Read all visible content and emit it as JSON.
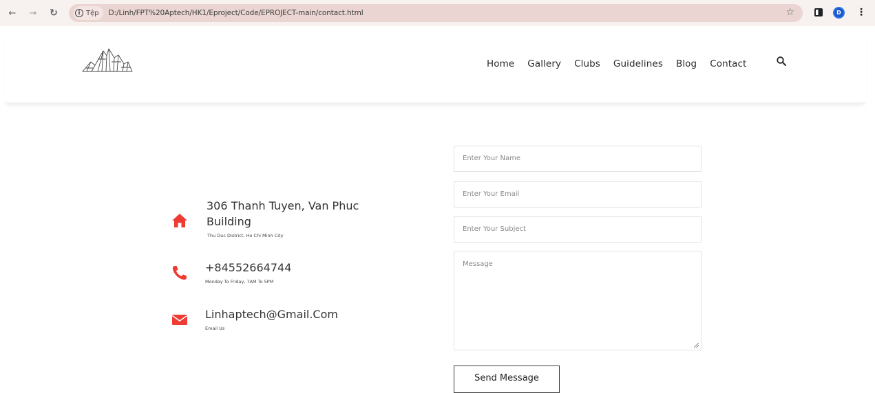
{
  "browser": {
    "site_label": "Tệp",
    "url": "D:/Linh/FPT%20Aptech/HK1/Eproject/Code/EPROJECT-main/contact.html",
    "profile_initial": "D"
  },
  "nav": {
    "items": [
      "Home",
      "Gallery",
      "Clubs",
      "Guidelines",
      "Blog",
      "Contact"
    ]
  },
  "contact": {
    "address": {
      "line1": "306 Thanh Tuyen, Van Phuc",
      "line2": "Building",
      "sub": "Thu Duc District, Ho Chi Minh City",
      "icon": "home-icon"
    },
    "phone": {
      "title": "+84552664744",
      "sub": "Monday To Friday, 7AM To 5PM",
      "icon": "phone-icon"
    },
    "email": {
      "title": "Linhaptech@Gmail.Com",
      "sub": "Email Us",
      "icon": "envelope-icon"
    },
    "accent_color": "#ee3b33"
  },
  "form": {
    "name_placeholder": "Enter Your Name",
    "email_placeholder": "Enter Your Email",
    "subject_placeholder": "Enter Your Subject",
    "message_placeholder": "Message",
    "submit_label": "Send Message"
  }
}
